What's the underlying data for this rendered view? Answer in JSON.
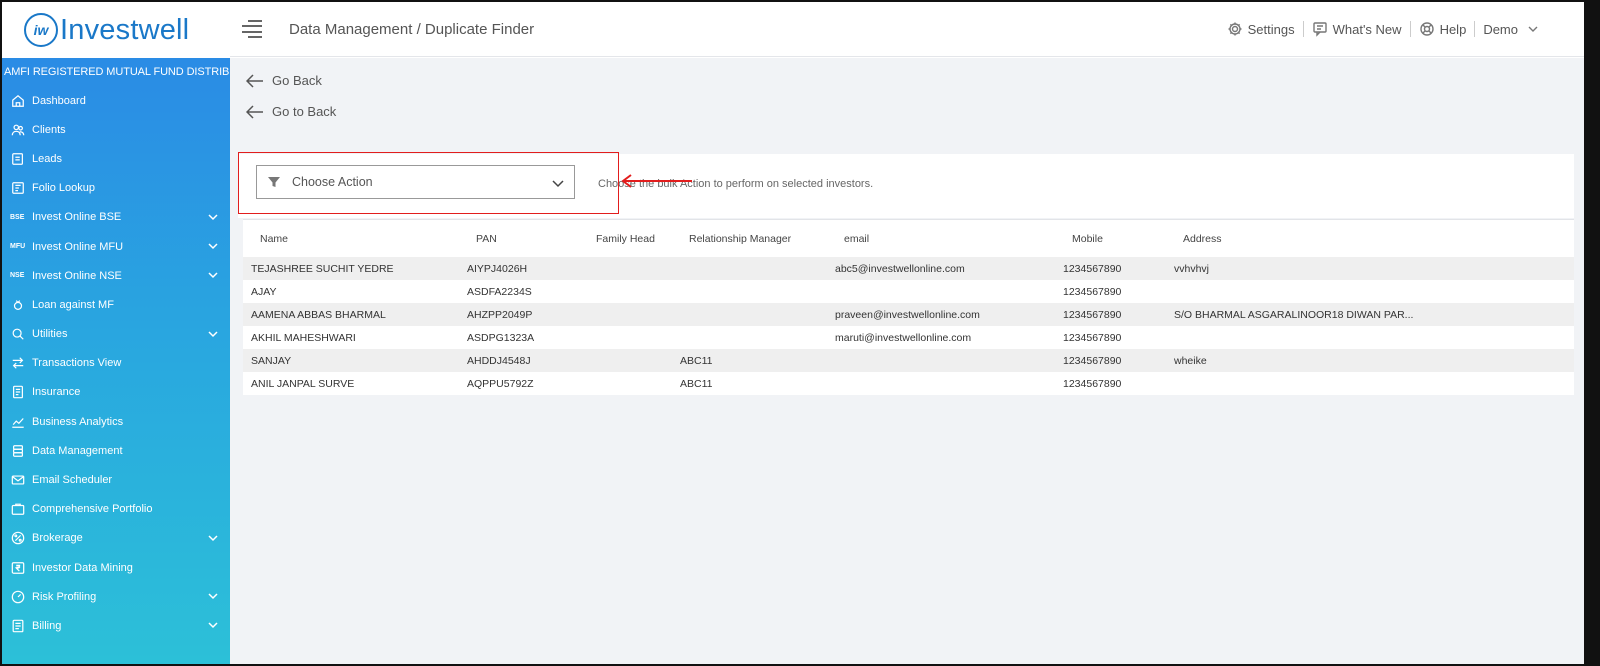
{
  "brand": {
    "logo_mark": "iw",
    "name": "Investwell",
    "tagline": "AMFI REGISTERED MUTUAL FUND DISTRIBUTOR"
  },
  "sidebar": {
    "items": [
      {
        "label": "Dashboard",
        "icon": "home-icon",
        "expandable": false
      },
      {
        "label": "Clients",
        "icon": "users-icon",
        "expandable": false
      },
      {
        "label": "Leads",
        "icon": "leads-icon",
        "expandable": false
      },
      {
        "label": "Folio Lookup",
        "icon": "folio-icon",
        "expandable": false
      },
      {
        "label": "Invest Online BSE",
        "tag": "BSE",
        "expandable": true
      },
      {
        "label": "Invest Online MFU",
        "tag": "MFU",
        "expandable": true
      },
      {
        "label": "Invest Online NSE",
        "tag": "NSE",
        "expandable": true
      },
      {
        "label": "Loan against MF",
        "icon": "loan-icon",
        "expandable": false
      },
      {
        "label": "Utilities",
        "icon": "utilities-icon",
        "expandable": true
      },
      {
        "label": "Transactions View",
        "icon": "transactions-icon",
        "expandable": false
      },
      {
        "label": "Insurance",
        "icon": "insurance-icon",
        "expandable": false
      },
      {
        "label": "Business Analytics",
        "icon": "analytics-icon",
        "expandable": false
      },
      {
        "label": "Data Management",
        "icon": "database-icon",
        "expandable": false,
        "active": true
      },
      {
        "label": "Email Scheduler",
        "icon": "email-icon",
        "expandable": false
      },
      {
        "label": "Comprehensive Portfolio",
        "icon": "portfolio-icon",
        "expandable": false
      },
      {
        "label": "Brokerage",
        "icon": "percent-icon",
        "expandable": true
      },
      {
        "label": "Investor Data Mining",
        "icon": "rupee-icon",
        "expandable": false
      },
      {
        "label": "Risk Profiling",
        "icon": "gauge-icon",
        "expandable": true
      },
      {
        "label": "Billing",
        "icon": "billing-icon",
        "expandable": true
      }
    ]
  },
  "header": {
    "breadcrumb": "Data Management / Duplicate Finder",
    "settings": "Settings",
    "whats_new": "What's New",
    "help": "Help",
    "user": "Demo"
  },
  "main": {
    "go_back": "Go Back",
    "go_to_back": "Go to Back",
    "action_select": "Choose Action",
    "action_hint": "Choose the bulk Action to perform on selected investors."
  },
  "table": {
    "columns": [
      "Name",
      "PAN",
      "Family Head",
      "Relationship Manager",
      "email",
      "Mobile",
      "Address"
    ],
    "rows": [
      [
        "TEJASHREE SUCHIT YEDRE",
        "AIYPJ4026H",
        "",
        "",
        "abc5@investwellonline.com",
        "1234567890",
        "vvhvhvj"
      ],
      [
        "AJAY",
        "ASDFA2234S",
        "",
        "",
        "",
        "1234567890",
        ""
      ],
      [
        "AAMENA ABBAS BHARMAL",
        "AHZPP2049P",
        "",
        "",
        "praveen@investwellonline.com",
        "1234567890",
        "S/O BHARMAL ASGARALINOOR18 DIWAN PAR..."
      ],
      [
        "AKHIL MAHESHWARI",
        "ASDPG1323A",
        "",
        "",
        "maruti@investwellonline.com",
        "1234567890",
        ""
      ],
      [
        "SANJAY",
        "AHDDJ4548J",
        "",
        "ABC11",
        "",
        "1234567890",
        "wheike"
      ],
      [
        "ANIL JANPAL SURVE",
        "AQPPU5792Z",
        "",
        "ABC11",
        "",
        "1234567890",
        ""
      ]
    ]
  },
  "colors": {
    "sidebar_top": "#2a86e6",
    "sidebar_bottom": "#2cc0d8",
    "brand": "#1a78c8",
    "highlight": "#e21d1d"
  }
}
